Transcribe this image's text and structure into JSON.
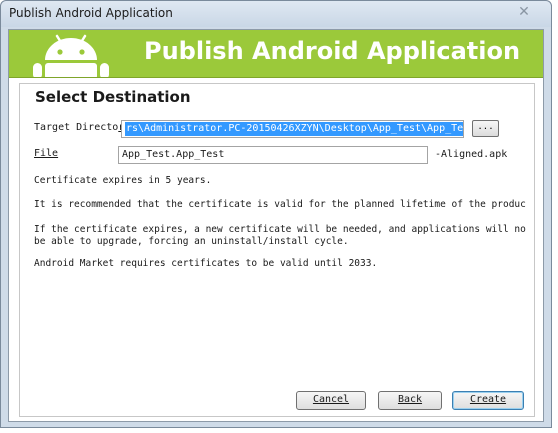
{
  "window": {
    "title": "Publish Android Application"
  },
  "banner": {
    "title": "Publish Android Application"
  },
  "page": {
    "heading": "Select Destination",
    "target_directory": {
      "label_part1": "Target Directo",
      "label_part2": "r",
      "value_selected": "rs\\Administrator.PC-20150426XZYN\\Desktop\\App_Test\\App_Test",
      "browse_label": "..."
    },
    "file": {
      "label": "File",
      "value": "App_Test.App_Test",
      "suffix": "-Aligned.apk"
    },
    "messages": [
      "Certificate expires in 5 years.",
      "It is recommended that the certificate is valid for the planned lifetime of the produc",
      "If the certificate expires, a new certificate will be needed, and applications will no",
      "be able to upgrade, forcing an uninstall/install cycle.",
      "Android Market requires certificates to be valid until 2033."
    ]
  },
  "buttons": {
    "cancel": "Cancel",
    "back": "Back",
    "create": "Create"
  },
  "colors": {
    "banner": "#9bc93a",
    "selection": "#3399ff"
  },
  "icons": {
    "logo": "android-robot-icon",
    "close": "close-icon"
  }
}
